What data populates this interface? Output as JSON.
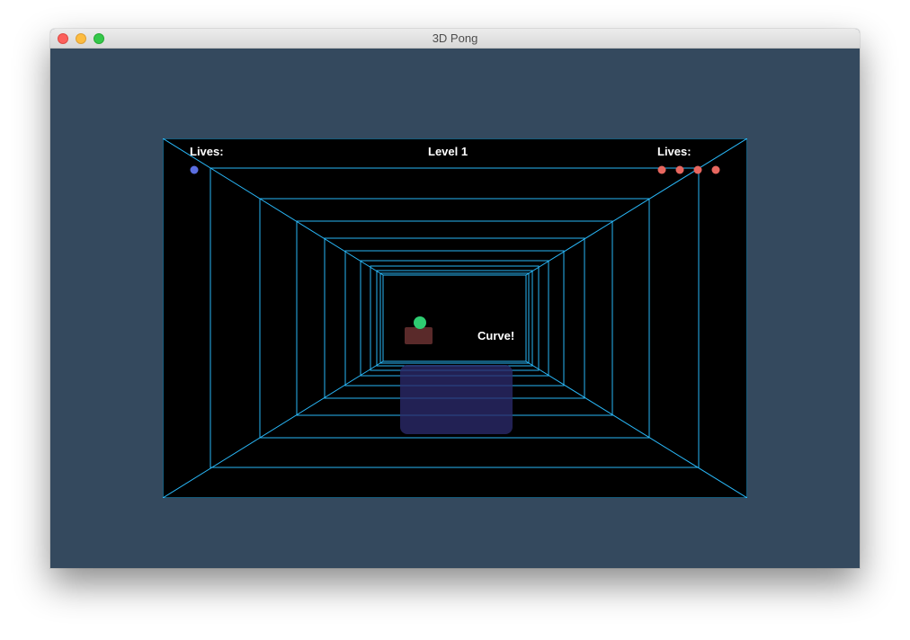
{
  "window": {
    "title": "3D Pong"
  },
  "hud": {
    "left_lives_label": "Lives:",
    "right_lives_label": "Lives:",
    "level_label": "Level 1",
    "status_text": "Curve!",
    "left_lives_count": 1,
    "right_lives_count": 4,
    "left_lives_color": "#5b6ee1",
    "right_lives_color": "#e8675f"
  },
  "scene": {
    "background": "#000000",
    "wall_line_color": "#29b6f6",
    "ball_color": "#2ecc71",
    "opponent_paddle_color": "#5a2a2a",
    "player_paddle_color": "#2b2a6b"
  }
}
